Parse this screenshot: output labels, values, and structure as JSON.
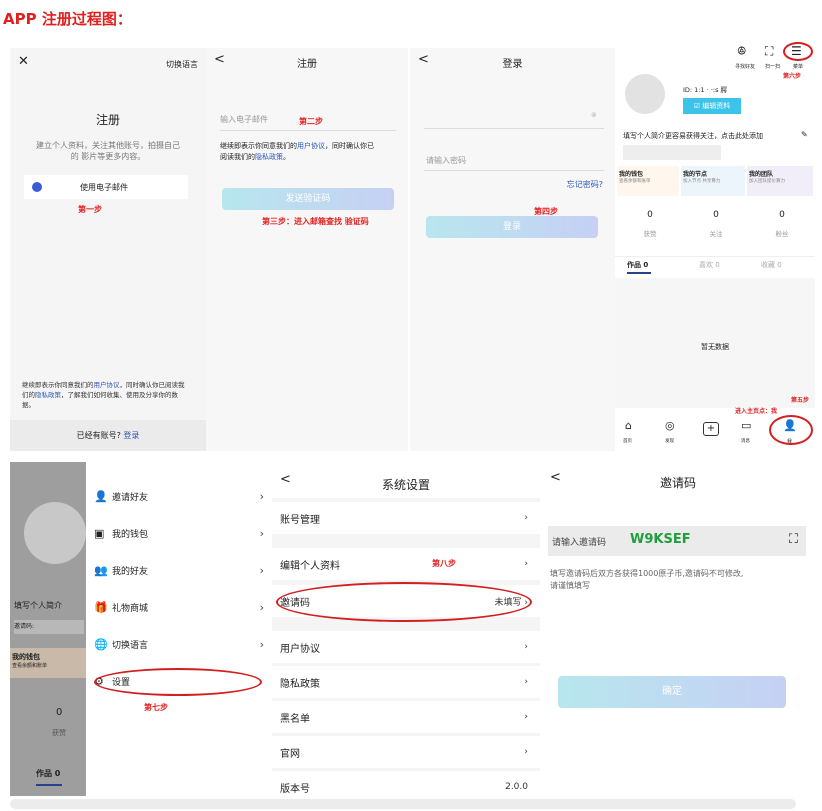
{
  "page_title": "APP 注册过程图：",
  "panel1": {
    "close": "✕",
    "switch_lang": "切换语言",
    "heading": "注册",
    "subtitle_line1": "建立个人资料，关注其他账号，拍摄自己",
    "subtitle_line2": "的 影片等更多内容。",
    "email_option": "使用电子邮件",
    "step": "第一步",
    "terms_line1_a": "继续即表示你同意我们的",
    "terms_line1_link": "用户协议",
    "terms_line1_b": "，同时确认你已阅读我",
    "terms_line2_a": "们的",
    "terms_line2_link": "隐私政策",
    "terms_line2_b": "，了解我们如何收集、使用及分享你的数",
    "terms_line3": "据。",
    "have_account": "已经有账号?",
    "login_link": "登录"
  },
  "panel2": {
    "back": "<",
    "title": "注册",
    "email_placeholder": "输入电子邮件",
    "step2": "第二步",
    "terms_a": "继续即表示你同意我们的",
    "terms_link1": "用户协议",
    "terms_b": "，同时确认你已",
    "terms_c": "阅读我们的",
    "terms_link2": "隐私政策",
    "terms_d": "。",
    "send_button": "发送验证码",
    "step3": "第三步：进入邮箱查找 验证码"
  },
  "panel3": {
    "back": "<",
    "title": "登录",
    "password_placeholder": "请输入密码",
    "forgot": "忘记密码?",
    "step4": "第四步",
    "login_button": "登录"
  },
  "panel4": {
    "top_labels": [
      "寻找好友",
      "扫一扫",
      "菜单"
    ],
    "step6": "第六步",
    "id_text": "ID: 1:1 · ·:s 腭",
    "edit_profile": "编辑资料",
    "bio_prompt": "填写个人简介更容易获得关注，点击此处添加",
    "cards": [
      {
        "title": "我的钱包",
        "sub": "查看余额和账单"
      },
      {
        "title": "我的节点",
        "sub": "加入节点 共享算力"
      },
      {
        "title": "我的团队",
        "sub": "加入团队提价算力"
      }
    ],
    "stats": [
      {
        "num": "0",
        "label": "获赞"
      },
      {
        "num": "0",
        "label": "关注"
      },
      {
        "num": "0",
        "label": "粉丝"
      }
    ],
    "tabs": [
      "作品 0",
      "喜欢 0",
      "收藏 0"
    ],
    "empty": "暂无数据",
    "step5_a": "第五步",
    "step5_b": "进入主页点：我",
    "nav": [
      "首页",
      "发现",
      "",
      "消息",
      "我"
    ]
  },
  "bottom_left": {
    "bio_partial": "填写个人简介",
    "invite_partial": "邀请码:",
    "wallet_partial": "我的钱包",
    "wallet_sub_partial": "查看余额和账单",
    "stat_num": "0",
    "stat_label": "获赞",
    "tab_partial": "作品 0"
  },
  "menu": {
    "items": [
      {
        "icon": "👤",
        "label": "邀请好友"
      },
      {
        "icon": "▣",
        "label": "我的钱包"
      },
      {
        "icon": "👥",
        "label": "我的好友"
      },
      {
        "icon": "🎁",
        "label": "礼物商城"
      },
      {
        "icon": "🌐",
        "label": "切换语言"
      },
      {
        "icon": "⚙",
        "label": "设置"
      }
    ],
    "step7": "第七步"
  },
  "settings": {
    "back": "<",
    "title": "系统设置",
    "rows": [
      {
        "label": "账号管理",
        "value": ""
      },
      {
        "label": "编辑个人资料",
        "value": ""
      },
      {
        "label": "邀请码",
        "value": "未填写"
      },
      {
        "label": "用户协议",
        "value": ""
      },
      {
        "label": "隐私政策",
        "value": ""
      },
      {
        "label": "黑名单",
        "value": ""
      },
      {
        "label": "官网",
        "value": ""
      },
      {
        "label": "版本号",
        "value": "2.0.0"
      }
    ],
    "step8": "第八步"
  },
  "invite": {
    "back": "<",
    "title": "邀请码",
    "placeholder": "请输入邀请码",
    "code": "W9KSEF",
    "notice_line1": "填写邀请码后双方各获得1000原子币,邀请码不可修改,",
    "notice_line2": "请谨慎填写",
    "confirm": "确定"
  }
}
